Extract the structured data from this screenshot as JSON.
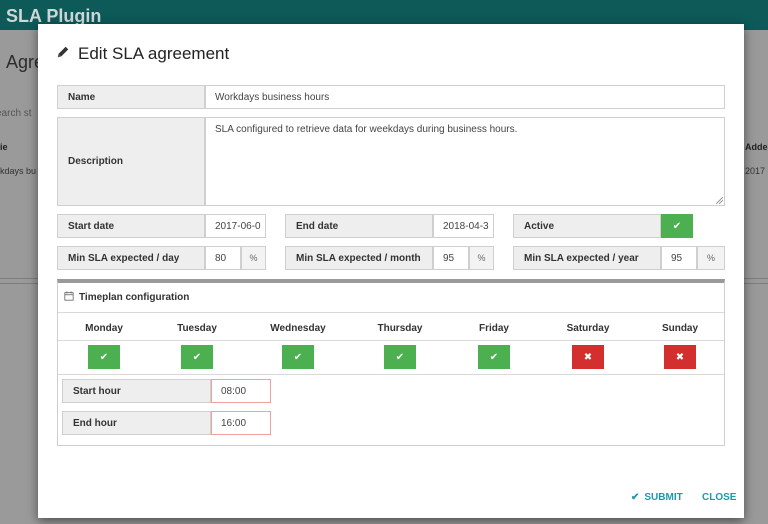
{
  "background": {
    "brand": "SLA Plugin",
    "page_title": "Agre",
    "search_placeholder": "earch st",
    "col_left": "ie",
    "col_right": "Adde",
    "row_cell_left": "kdays bu",
    "row_cell_right": "2017"
  },
  "modal": {
    "title": "Edit SLA agreement",
    "fields": {
      "name_label": "Name",
      "name_value": "Workdays business hours",
      "description_label": "Description",
      "description_value": "SLA configured to retrieve data for weekdays during business hours.",
      "start_date_label": "Start date",
      "start_date_value": "2017-06-0",
      "end_date_label": "End date",
      "end_date_value": "2018-04-3",
      "active_label": "Active",
      "active_value": true,
      "min_day_label": "Min SLA expected / day",
      "min_day_value": "80",
      "min_month_label": "Min SLA expected / month",
      "min_month_value": "95",
      "min_year_label": "Min SLA expected / year",
      "min_year_value": "95",
      "percent_symbol": "%"
    },
    "timeplan": {
      "title": "Timeplan configuration",
      "days": [
        {
          "label": "Monday",
          "enabled": true
        },
        {
          "label": "Tuesday",
          "enabled": true
        },
        {
          "label": "Wednesday",
          "enabled": true
        },
        {
          "label": "Thursday",
          "enabled": true
        },
        {
          "label": "Friday",
          "enabled": true
        },
        {
          "label": "Saturday",
          "enabled": false
        },
        {
          "label": "Sunday",
          "enabled": false
        }
      ],
      "start_hour_label": "Start hour",
      "start_hour_value": "08:00",
      "end_hour_label": "End hour",
      "end_hour_value": "16:00"
    },
    "footer": {
      "submit_label": "SUBMIT",
      "close_label": "CLOSE"
    }
  },
  "colors": {
    "topbar": "#0d5a59",
    "check_on": "#4caf50",
    "check_off": "#d32f2f",
    "action": "#1b9aaa"
  }
}
